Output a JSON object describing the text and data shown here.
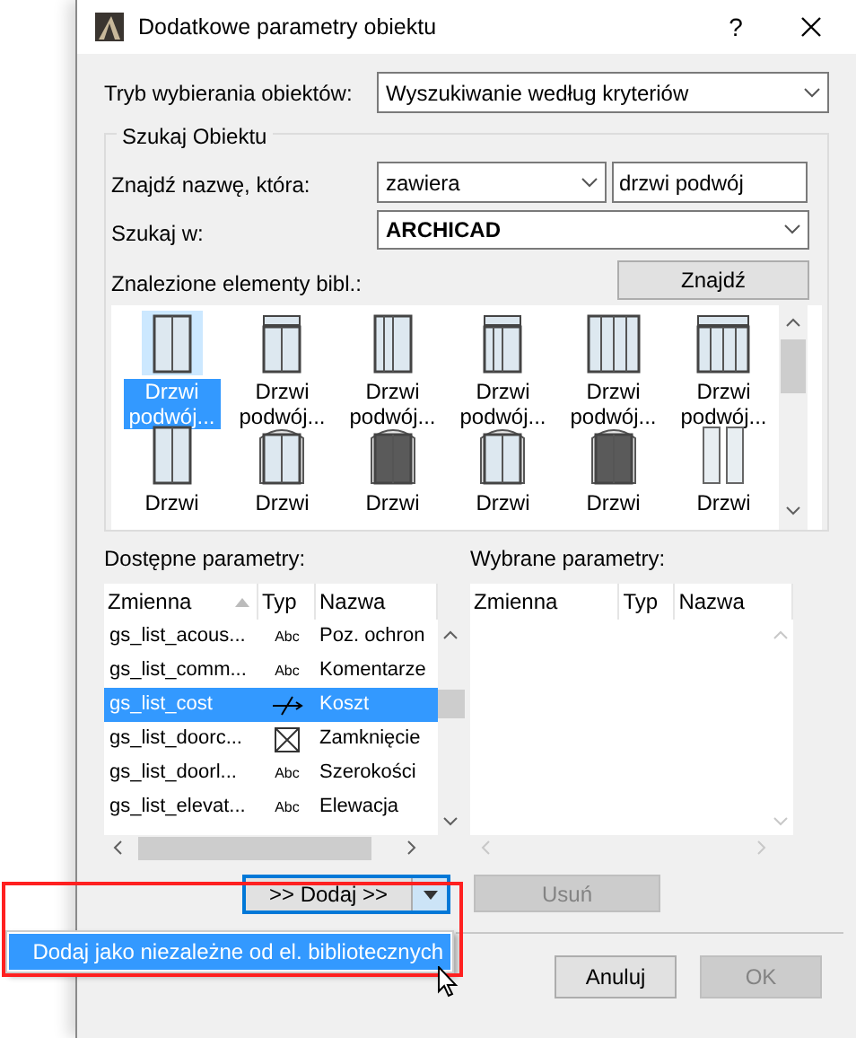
{
  "window": {
    "title": "Dodatkowe parametry obiektu",
    "help": "?"
  },
  "selection_mode": {
    "label": "Tryb wybierania obiektów:",
    "value": "Wyszukiwanie według kryteriów"
  },
  "search_group": {
    "title": "Szukaj Obiektu",
    "name_label": "Znajdź nazwę, która:",
    "condition": "zawiera",
    "name_value": "drzwi podwój",
    "search_in_label": "Szukaj w:",
    "search_in": "ARCHICAD",
    "find_button": "Znajdź",
    "results_label": "Znalezione elementy bibl.:",
    "results": [
      {
        "label": "Drzwi podwój...",
        "kind": "double",
        "selected": true
      },
      {
        "label": "Drzwi podwój...",
        "kind": "transom",
        "selected": false
      },
      {
        "label": "Drzwi podwój...",
        "kind": "sidelight",
        "selected": false
      },
      {
        "label": "Drzwi podwój...",
        "kind": "transomsidelight",
        "selected": false
      },
      {
        "label": "Drzwi podwój...",
        "kind": "wide",
        "selected": false
      },
      {
        "label": "Drzwi podwój...",
        "kind": "widetransom",
        "selected": false
      },
      {
        "label": "Drzwi",
        "kind": "double",
        "selected": false
      },
      {
        "label": "Drzwi",
        "kind": "arched",
        "selected": false
      },
      {
        "label": "Drzwi",
        "kind": "archeddark",
        "selected": false
      },
      {
        "label": "Drzwi",
        "kind": "arched",
        "selected": false
      },
      {
        "label": "Drzwi",
        "kind": "archeddark",
        "selected": false
      },
      {
        "label": "Drzwi",
        "kind": "split",
        "selected": false
      }
    ]
  },
  "available": {
    "label": "Dostępne parametry:",
    "columns": [
      "Zmienna",
      "Typ",
      "Nazwa"
    ],
    "rows": [
      {
        "variable": "gs_list_acous...",
        "kind": "text",
        "type": "Abc",
        "name": "Poz. ochron",
        "selected": false
      },
      {
        "variable": "gs_list_comm...",
        "kind": "text",
        "type": "Abc",
        "name": "Komentarze",
        "selected": false
      },
      {
        "variable": "gs_list_cost",
        "kind": "length",
        "name": "Koszt",
        "selected": true
      },
      {
        "variable": "gs_list_doorc...",
        "kind": "boolean",
        "name": "Zamknięcie",
        "selected": false
      },
      {
        "variable": "gs_list_doorl...",
        "kind": "text",
        "type": "Abc",
        "name": "Szerokości",
        "selected": false
      },
      {
        "variable": "gs_list_elevat...",
        "kind": "text",
        "type": "Abc",
        "name": "Elewacja",
        "selected": false
      }
    ]
  },
  "selected_params": {
    "label": "Wybrane parametry:",
    "columns": [
      "Zmienna",
      "Typ",
      "Nazwa"
    ]
  },
  "add_button": ">> Dodaj >>",
  "add_menu": {
    "items": [
      {
        "label": "Dodaj jako niezależne od el. bibliotecznych",
        "selected": true
      }
    ]
  },
  "remove_button": {
    "label": "Usuń",
    "disabled": true
  },
  "buttons": [
    {
      "label": "Anuluj",
      "disabled": false
    },
    {
      "label": "OK",
      "disabled": true
    }
  ]
}
